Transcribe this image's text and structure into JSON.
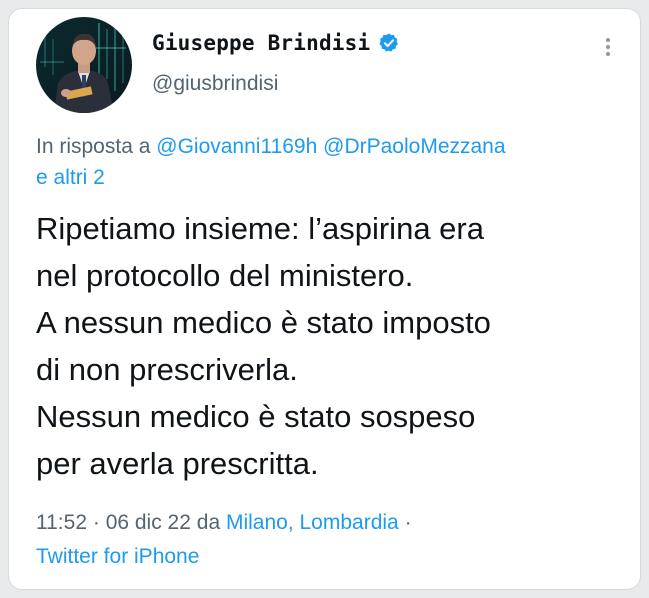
{
  "tweet": {
    "author": {
      "display_name": "Giuseppe Brindisi",
      "handle": "@giusbrindisi",
      "verified": true
    },
    "icons": {
      "avatar": "user-avatar-photo",
      "verified": "verified-badge-icon",
      "more": "more-options-icon"
    },
    "reply_to": {
      "prefix": "In risposta a",
      "mention_1": "@Giovanni1169h",
      "mention_2": "@DrPaoloMezzana",
      "others": "e altri 2"
    },
    "text_lines": [
      "Ripetiamo insieme: l’aspirina era",
      "nel protocollo del ministero.",
      "A nessun medico è stato imposto",
      "di non prescriverla.",
      "Nessun medico è stato sospeso",
      "per averla prescritta."
    ],
    "meta": {
      "time": "11:52",
      "date": "06 dic 22",
      "location_prefix": "da",
      "location": "Milano, Lombardia",
      "source": "Twitter for iPhone"
    },
    "colors": {
      "link": "#1d9bf0",
      "secondary_text": "#536471",
      "primary_text": "#0f1419",
      "verified_badge": "#1d9bf0"
    }
  }
}
